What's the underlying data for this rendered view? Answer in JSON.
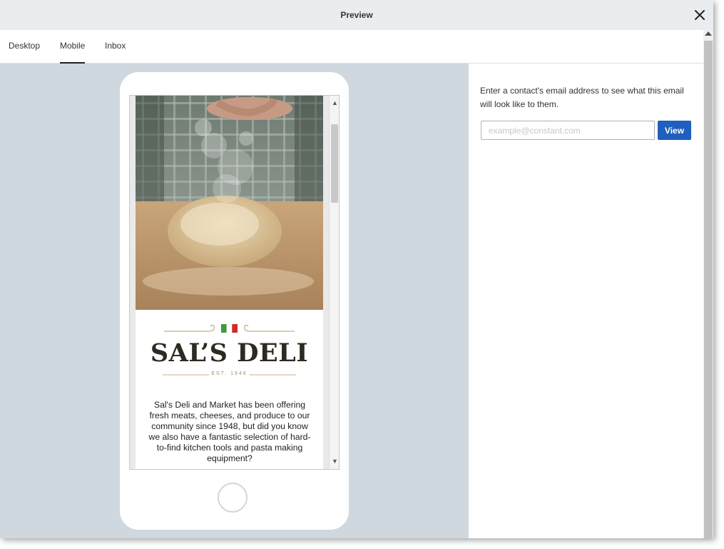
{
  "header": {
    "title": "Preview"
  },
  "tabs": [
    {
      "label": "Desktop"
    },
    {
      "label": "Mobile"
    },
    {
      "label": "Inbox"
    }
  ],
  "active_tab": "Mobile",
  "email_preview": {
    "brand": "SAL’S DELI",
    "established": "EST. 1948",
    "blurb": "Sal's Deli and Market has been offering fresh meats, cheeses, and produce to our community since 1948, but did you know we also have a fantastic selection of hard-to-find kitchen tools and pasta making equipment?"
  },
  "right_panel": {
    "instructions": "Enter a contact's email address to see what this email will look like to them.",
    "email_placeholder": "example@constant.com",
    "view_label": "View"
  },
  "colors": {
    "header_bg": "#e9edf0",
    "preview_bg": "#cfd8de",
    "accent_button": "#1f5fbd",
    "flag_green": "#3f9a3e",
    "flag_white": "#ffffff",
    "flag_red": "#cf2b2b"
  },
  "icons": {
    "close": "close-icon",
    "scroll_up": "chevron-up-icon",
    "scroll_down": "chevron-down-icon"
  }
}
